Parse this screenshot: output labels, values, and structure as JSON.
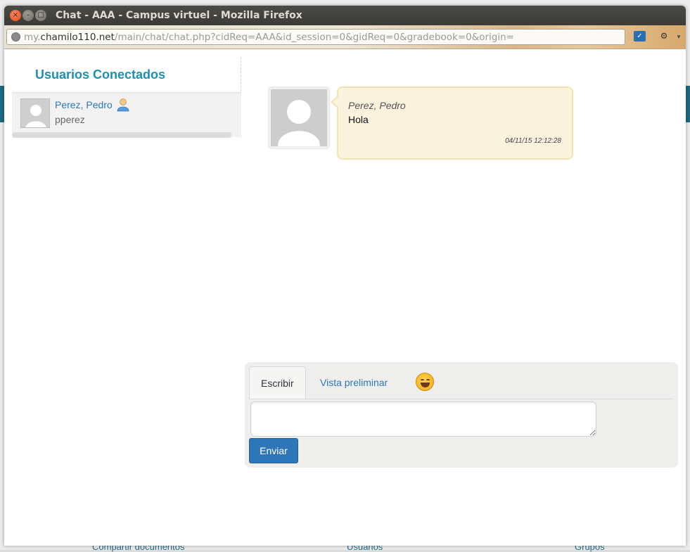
{
  "window": {
    "title": "Chat - AAA - Campus virtuel - Mozilla Firefox",
    "close_glyph": "×",
    "min_glyph": "–",
    "max_glyph": "□"
  },
  "browser": {
    "url_prefix": "my.",
    "url_host": "chamilo110.net",
    "url_path": "/main/chat/chat.php?cidReq=AAA&id_session=0&gidReq=0&gradebook=0&origin=",
    "menu_glyph": "▾"
  },
  "sidebar": {
    "title": "Usuarios Conectados",
    "users": [
      {
        "name": "Perez, Pedro",
        "username": "pperez"
      }
    ]
  },
  "messages": [
    {
      "author": "Perez, Pedro",
      "text": "Hola",
      "time": "04/11/15 12:12:28"
    }
  ],
  "composer": {
    "tab_write": "Escribir",
    "tab_preview": "Vista preliminar",
    "input_value": "",
    "send_label": "Enviar"
  },
  "background_page": {
    "links": [
      "Compartir documentos",
      "Usuarios",
      "Grupos"
    ]
  },
  "colors": {
    "accent": "#1a90b4",
    "link": "#2b79b8",
    "send_button": "#2f76b9",
    "bubble": "#fbf3de"
  }
}
